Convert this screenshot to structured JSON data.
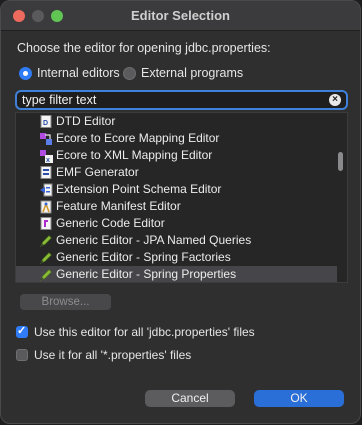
{
  "window": {
    "title": "Editor Selection"
  },
  "prompt": "Choose the editor for opening jdbc.properties:",
  "radios": [
    {
      "label": "Internal editors",
      "selected": true
    },
    {
      "label": "External programs",
      "selected": false
    }
  ],
  "filter": {
    "placeholder": "type filter text",
    "value": ""
  },
  "editors": [
    {
      "label": "DTD Editor",
      "icon": "dtd-document-icon"
    },
    {
      "label": "Ecore to Ecore Mapping Editor",
      "icon": "ecore-mapping-icon"
    },
    {
      "label": "Ecore to XML Mapping Editor",
      "icon": "xml-mapping-icon"
    },
    {
      "label": "EMF Generator",
      "icon": "emf-generator-icon"
    },
    {
      "label": "Extension Point Schema Editor",
      "icon": "schema-editor-icon"
    },
    {
      "label": "Feature Manifest Editor",
      "icon": "feature-manifest-icon"
    },
    {
      "label": "Generic Code Editor",
      "icon": "code-editor-icon"
    },
    {
      "label": "Generic Editor - JPA Named Queries",
      "icon": "pen-icon"
    },
    {
      "label": "Generic Editor - Spring Factories",
      "icon": "pen-icon"
    },
    {
      "label": "Generic Editor - Spring Properties",
      "icon": "pen-icon",
      "selected": true
    }
  ],
  "browse_label": "Browse...",
  "options": [
    {
      "label": "Use this editor for all 'jdbc.properties' files",
      "checked": true
    },
    {
      "label": "Use it for all '*.properties' files",
      "checked": false
    }
  ],
  "buttons": {
    "cancel": "Cancel",
    "ok": "OK"
  },
  "colors": {
    "accent": "#2f7cf6",
    "ok_button": "#2a6ed8",
    "close": "#ed6a5e",
    "maximize": "#61c554"
  }
}
